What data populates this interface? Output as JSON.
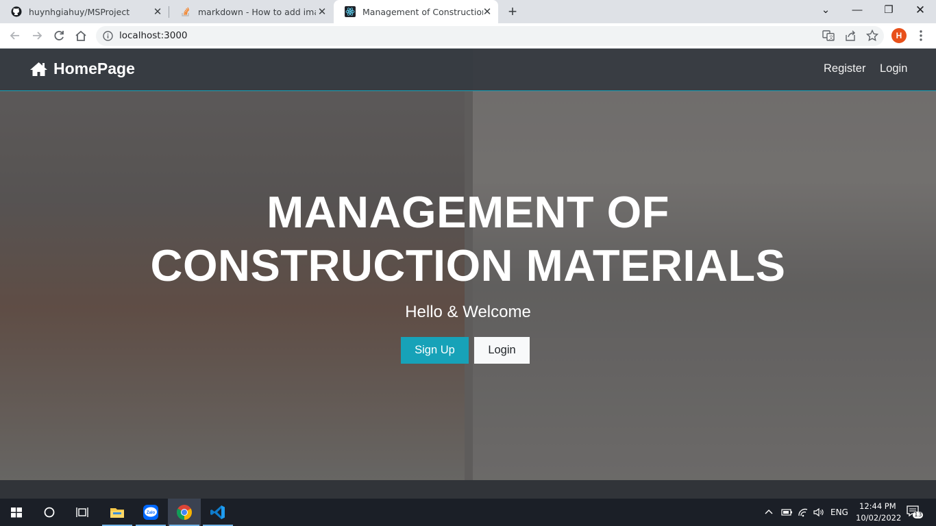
{
  "browser": {
    "tabs": [
      {
        "title": "huynhgiahuy/MSProject",
        "icon": "github-icon"
      },
      {
        "title": "markdown - How to add images",
        "icon": "stackoverflow-icon"
      },
      {
        "title": "Management of Construction Ma",
        "icon": "react-icon",
        "active": true
      }
    ],
    "url": "localhost:3000",
    "profile_initial": "H"
  },
  "navbar": {
    "brand": "HomePage",
    "links": [
      "Register",
      "Login"
    ]
  },
  "hero": {
    "title_line1": "MANAGEMENT OF",
    "title_line2": "CONSTRUCTION MATERIALS",
    "subtitle": "Hello & Welcome",
    "signup_label": "Sign Up",
    "login_label": "Login"
  },
  "colors": {
    "accent": "#17a2b8",
    "navbar": "#343a40"
  },
  "taskbar": {
    "apps": [
      "start-icon",
      "search-icon",
      "task-view-icon",
      "file-explorer-icon",
      "zalo-icon",
      "chrome-icon",
      "vscode-icon"
    ],
    "lang": "ENG",
    "time": "12:44 PM",
    "date": "10/02/2022",
    "notifications": "13",
    "zalo_label": "Zalo"
  }
}
